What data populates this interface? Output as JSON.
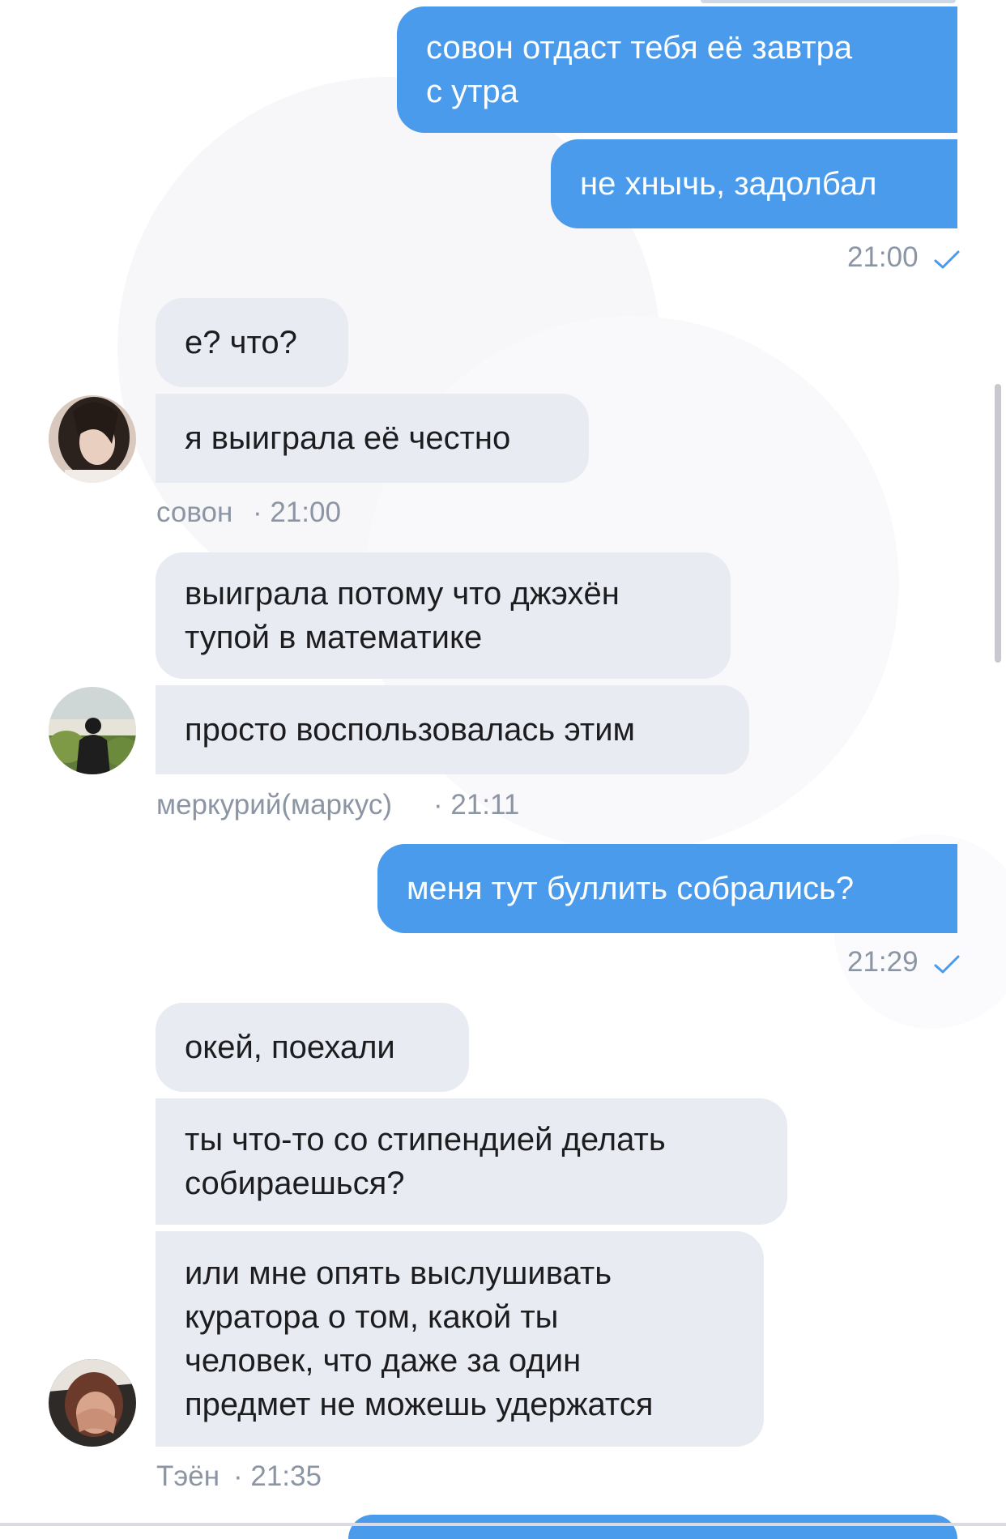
{
  "colors": {
    "outgoing_bubble": "#4a9bec",
    "incoming_bubble": "#e9ebf2",
    "meta_text": "#8c95a3",
    "check": "#4a9bec"
  },
  "messages": {
    "out_1_a": "совон отдаст тебя её завтра\nс утра",
    "out_1_b": "не хнычь, задолбал",
    "out_1_time": "21:00",
    "sowon_1": "е? что?",
    "sowon_2": "я выиграла её честно",
    "sowon_name": "совон",
    "sowon_time": "· 21:00",
    "merc_1": "выиграла потому что джэхён\nтупой в математике",
    "merc_2": "просто воспользовалась этим",
    "merc_name": "меркурий(маркус)",
    "merc_time": "· 21:11",
    "out_2": "меня тут буллить собрались?",
    "out_2_time": "21:29",
    "taeyong_1": "окей, поехали",
    "taeyong_2": "ты что-то со стипендией делать\nсобираешься?",
    "taeyong_3": "или мне опять выслушивать\nкуратора о том, какой ты\nчеловек, что даже за один\nпредмет не можешь удержатся",
    "taeyong_name": "Тэён",
    "taeyong_time": "· 21:35"
  },
  "icons": {
    "read": "check-icon",
    "avatar": "avatar-photo"
  }
}
